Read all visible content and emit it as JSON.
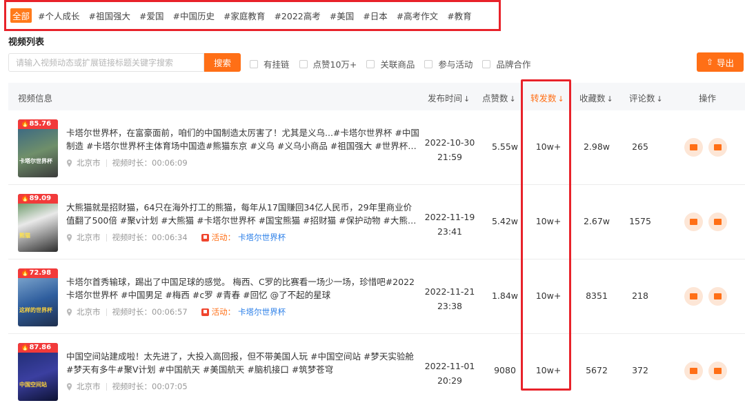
{
  "tags": [
    "全部",
    "#个人成长",
    "#祖国强大",
    "#爱国",
    "#中国历史",
    "#家庭教育",
    "#2022高考",
    "#美国",
    "#日本",
    "#高考作文",
    "#教育"
  ],
  "section_title": "视频列表",
  "search": {
    "placeholder": "请输入视频动态或扩展链接标题关键字搜索",
    "button": "搜索"
  },
  "filters": [
    "有挂链",
    "点赞10万+",
    "关联商品",
    "参与活动",
    "品牌合作"
  ],
  "export_label": "导出",
  "columns": {
    "info": "视频信息",
    "time": "发布时间",
    "likes": "点赞数",
    "shares": "转发数",
    "favs": "收藏数",
    "comments": "评论数",
    "ops": "操作"
  },
  "sort_arrow": "↓",
  "meta_labels": {
    "duration_prefix": "视频时长：",
    "activity": "活动："
  },
  "rows": [
    {
      "heat": "85.76",
      "thumb_caption": "卡塔尔世界杯",
      "title": "卡塔尔世界杯，在富豪面前，咱们的中国制造太厉害了！尤其是义乌...#卡塔尔世界杯 #中国制造 #卡塔尔世界杯主体育场中国造#熊猫东京 #义乌 #义乌小商品 #祖国强大 #世界杯预测 ...",
      "location": "北京市",
      "duration": "00:06:09",
      "activity": "",
      "date": "2022-10-30",
      "time": "21:59",
      "likes": "5.55w",
      "shares": "10w+",
      "favs": "2.98w",
      "comments": "265"
    },
    {
      "heat": "89.09",
      "thumb_caption": "熊猫",
      "title": "大熊猫就是招财猫，64只在海外打工的熊猫，每年从17国赚回34亿人民币，29年里商业价值翻了500倍 #聚v计划 #大熊猫 #卡塔尔世界杯 #国宝熊猫 #招财猫 #保护动物 #大熊猫团团去世...",
      "location": "北京市",
      "duration": "00:06:34",
      "activity": "卡塔尔世界杯",
      "date": "2022-11-19",
      "time": "23:41",
      "likes": "5.42w",
      "shares": "10w+",
      "favs": "2.67w",
      "comments": "1575"
    },
    {
      "heat": "72.98",
      "thumb_caption": "这样的世界杯",
      "title": "卡塔尔首秀输球，踢出了中国足球的感觉。 梅西、C罗的比赛看一场少一场，珍惜吧#2022卡塔尔世界杯 #中国男足 #梅西 #c罗 #青春 #回忆 @了不起的星球",
      "location": "北京市",
      "duration": "00:06:57",
      "activity": "卡塔尔世界杯",
      "date": "2022-11-21",
      "time": "23:38",
      "likes": "1.84w",
      "shares": "10w+",
      "favs": "8351",
      "comments": "218"
    },
    {
      "heat": "87.86",
      "thumb_caption": "中国空间站",
      "title": "中国空间站建成啦！太先进了，大投入高回报，但不带美国人玩 #中国空间站 #梦天实验舱 #梦天有多牛#聚V计划 #中国航天 #美国航天 #脑机接口 #筑梦苍穹",
      "location": "北京市",
      "duration": "00:07:05",
      "activity": "",
      "date": "2022-11-01",
      "time": "20:29",
      "likes": "9080",
      "shares": "10w+",
      "favs": "5672",
      "comments": "372"
    }
  ],
  "colors": {
    "accent": "#ff6f16",
    "highlight_border": "#e8222a",
    "heat_badge": "#f23a3a",
    "activity_link": "#2b7fe8"
  }
}
